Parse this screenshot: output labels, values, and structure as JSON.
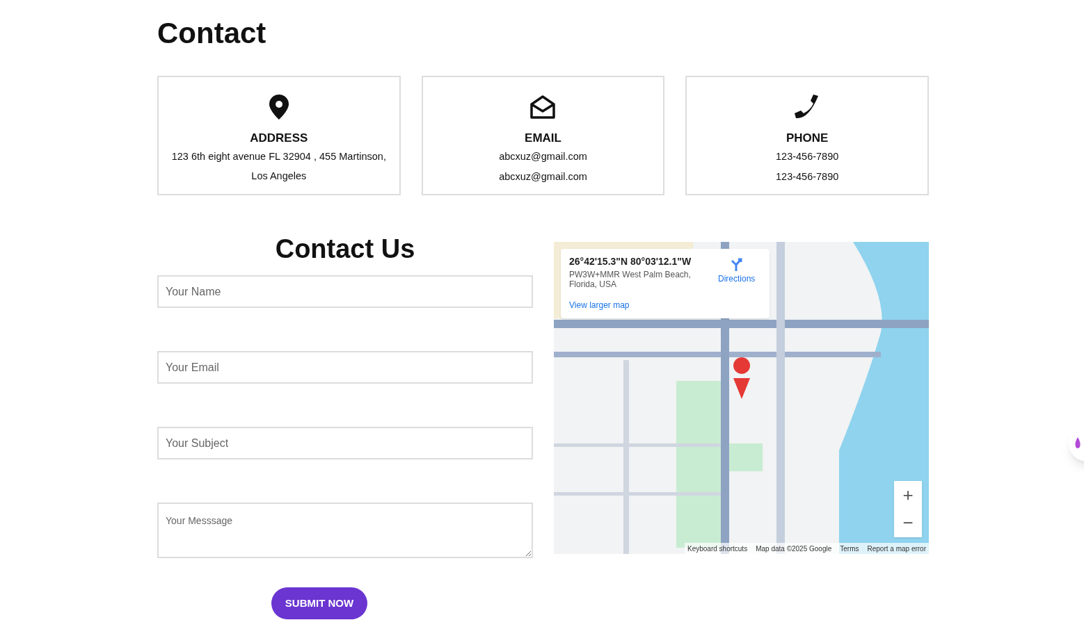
{
  "heading": "Contact",
  "info_cards": [
    {
      "kind": "address",
      "title": "ADDRESS",
      "lines": [
        "123 6th eight avenue FL 32904 , 455 Martinson, Los Angeles"
      ]
    },
    {
      "kind": "email",
      "title": "EMAIL",
      "lines": [
        "abcxuz@gmail.com",
        "abcxuz@gmail.com"
      ]
    },
    {
      "kind": "phone",
      "title": "PHONE",
      "lines": [
        "123-456-7890",
        "123-456-7890"
      ]
    }
  ],
  "form": {
    "title": "Contact Us",
    "fields": [
      {
        "kind": "input",
        "placeholder": "Your Name"
      },
      {
        "kind": "input",
        "placeholder": "Your Email"
      },
      {
        "kind": "input",
        "placeholder": "Your Subject"
      },
      {
        "kind": "textarea",
        "placeholder": "Your Messsage"
      }
    ],
    "submit": "SUBMIT NOW"
  },
  "map": {
    "coords": "26°42'15.3\"N 80°03'12.1\"W",
    "address": "PW3W+MMR West Palm Beach, Florida, USA",
    "directions": "Directions",
    "larger_map": "View larger map",
    "zoom_in": "+",
    "zoom_out": "−",
    "footer": [
      "Keyboard shortcuts",
      "Map data ©2025 Google",
      "Terms",
      "Report a map error"
    ]
  }
}
